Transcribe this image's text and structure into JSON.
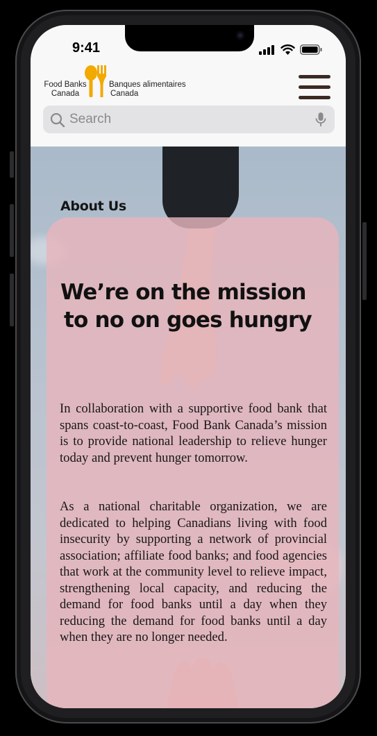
{
  "status_bar": {
    "time": "9:41"
  },
  "header": {
    "logo": {
      "left_line1": "Food Banks",
      "left_line2": "Canada",
      "right_line1": "Banques alimentaires",
      "right_line2": "Canada",
      "brand_color": "#f2a900"
    },
    "menu_icon": "hamburger-menu-icon",
    "search": {
      "placeholder": "Search",
      "icon": "search-icon",
      "voice_icon": "microphone-icon"
    }
  },
  "main": {
    "section_label": "About Us",
    "card": {
      "title_line1": "We’re on the mission",
      "title_line2": "to no on goes hungry",
      "paragraph1": "In collaboration with a supportive food bank that spans coast-to-coast, Food Bank Canada’s mission is to provide national leadership to relieve hunger today and prevent hunger tomorrow.",
      "paragraph2": "As a national charitable organization, we are dedicated to helping Canadians living with food insecurity by supporting a network of provincial association; affiliate food banks; and food agencies that work at the community level to relieve impact, strengthening local capacity, and reducing the demand for food banks until a day when they reducing the demand for food banks until a day when they are no longer needed.",
      "background_color": "#e7b5bc"
    }
  }
}
